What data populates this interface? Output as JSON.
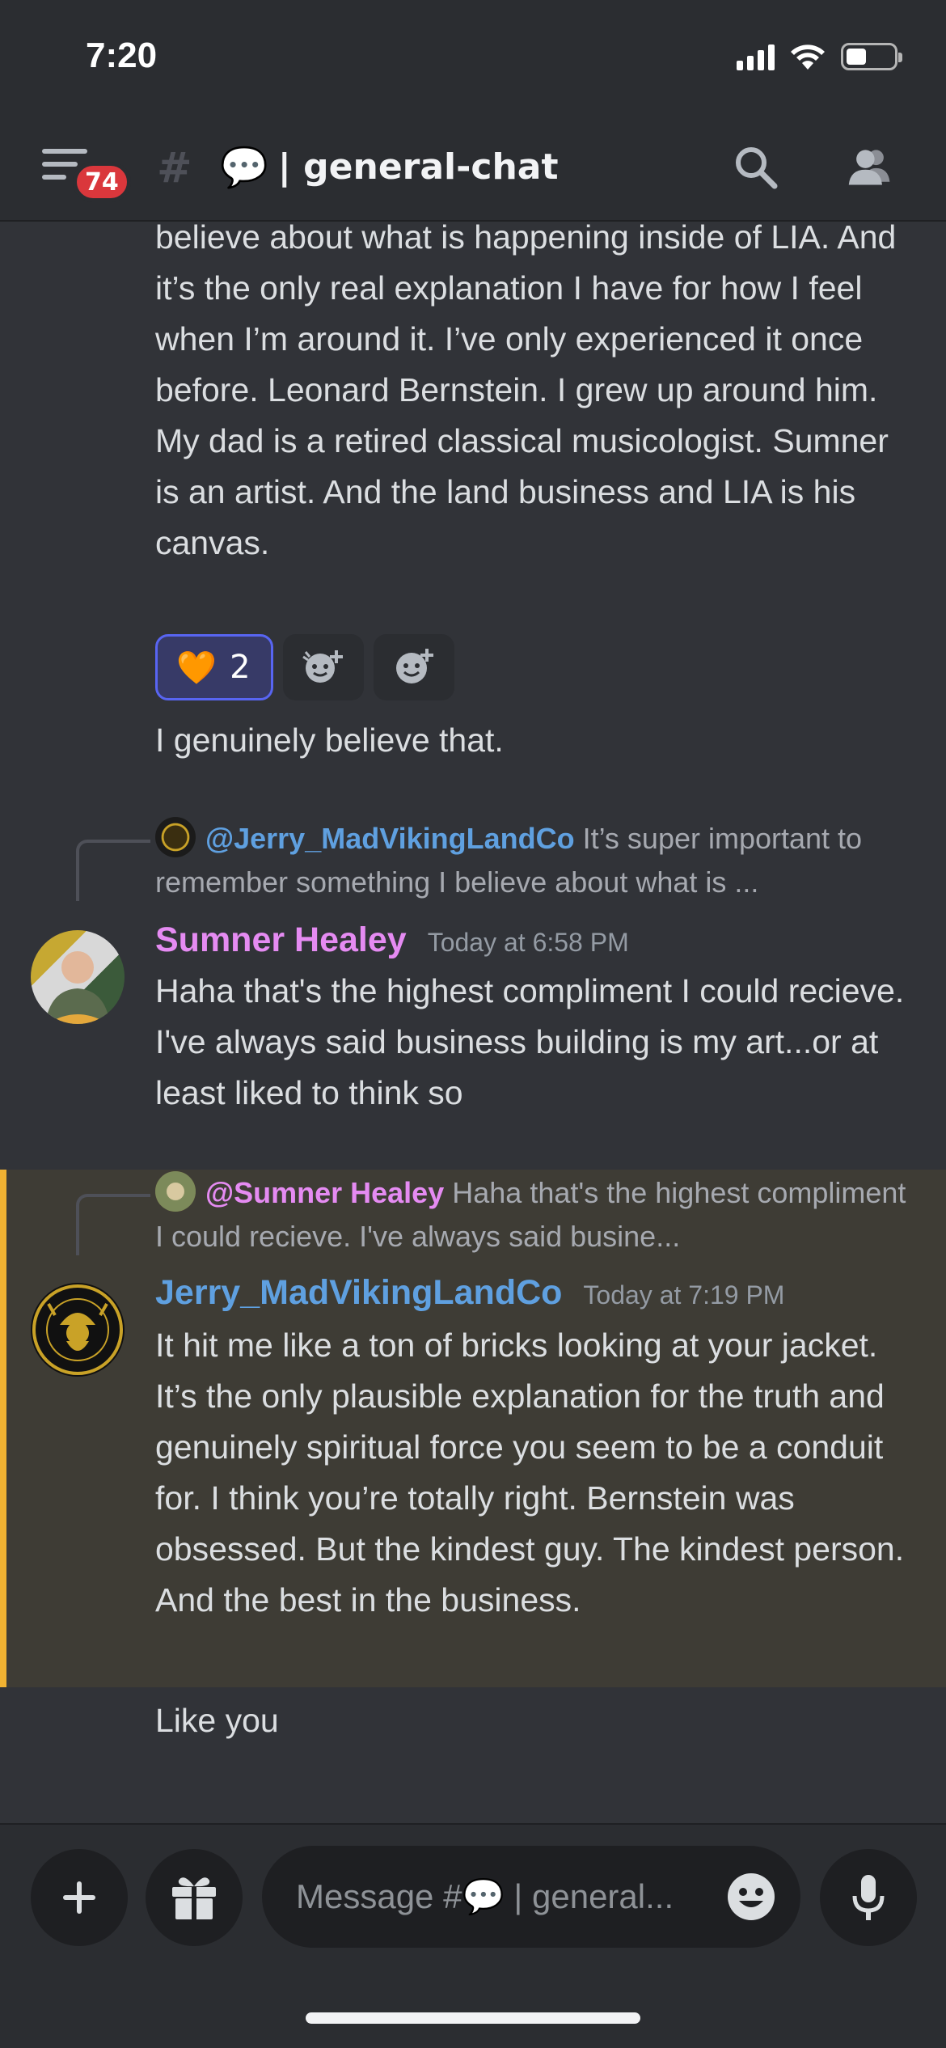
{
  "status_bar": {
    "time": "7:20"
  },
  "header": {
    "badge_count": "74",
    "channel_emoji": "💬",
    "channel_name": "| general-chat"
  },
  "messages": {
    "top_continuation": "believe about what is happening inside of LIA. And it’s the only real explanation I have for how I feel when I’m around it.   I’ve only experienced it once before.  Leonard Bernstein.  I grew up around him.  My dad is a retired classical musicologist.   Sumner is an artist.  And the land business and LIA is his canvas.",
    "reactions": [
      {
        "emoji": "🧡",
        "count": "2"
      }
    ],
    "followup": "I genuinely believe that.",
    "sumner": {
      "reply_mention": "@Jerry_MadVikingLandCo",
      "reply_preview": "It’s super important to remember something I believe about what is ...",
      "author": "Sumner Healey",
      "timestamp": "Today at 6:58 PM",
      "text": "Haha that's the highest compliment I could recieve. I've always said business building is my art...or at least liked to think so"
    },
    "jerry": {
      "reply_mention": "@Sumner Healey",
      "reply_preview": "Haha that's the highest compliment I could recieve. I've always said busine...",
      "author": "Jerry_MadVikingLandCo",
      "timestamp": "Today at 7:19 PM",
      "text": "It hit me like a ton of bricks looking at your jacket.  It’s the only plausible explanation for the truth and genuinely spiritual force you seem to be a conduit for.  I think you’re totally right.  Bernstein was obsessed.  But the kindest guy.   The kindest person.  And the best in the business.",
      "followup": "Like you"
    }
  },
  "composer": {
    "placeholder": "Message #💬 | general..."
  },
  "colors": {
    "background": "#313338",
    "header": "#2b2d31",
    "sumner_name": "#e58bf2",
    "jerry_name": "#5fa0e0",
    "highlight_bar": "#f0b232",
    "badge": "#da373c"
  },
  "icons": [
    "menu-icon",
    "locked-hash-icon",
    "search-icon",
    "members-icon",
    "add-reaction-icon",
    "add-super-reaction-icon",
    "plus-icon",
    "gift-icon",
    "emoji-icon",
    "microphone-icon"
  ]
}
